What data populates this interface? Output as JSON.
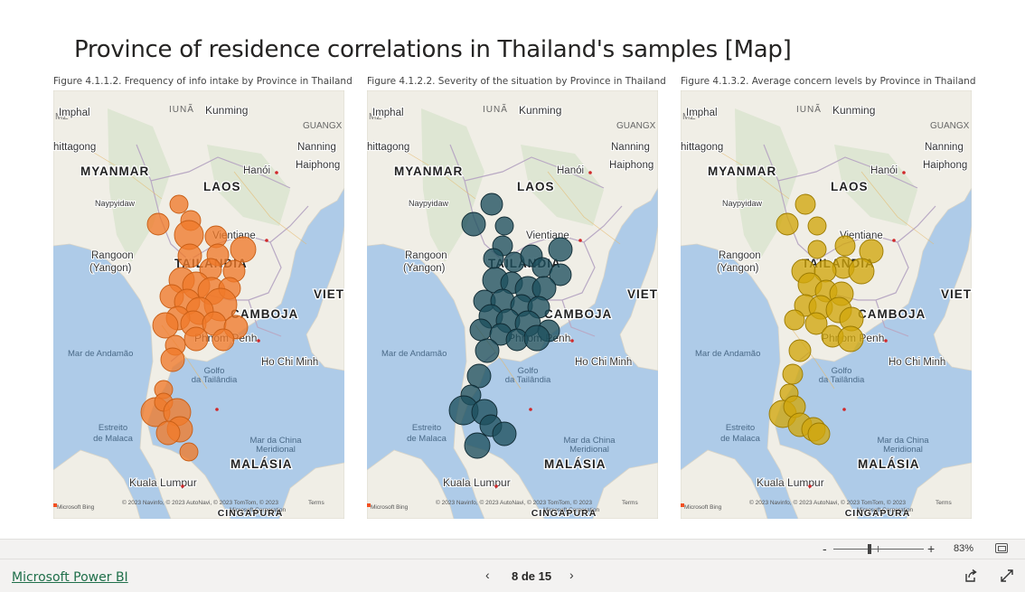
{
  "report": {
    "title": "Province of residence correlations in Thailand's samples [Map]"
  },
  "panels": [
    {
      "caption": "Figure 4.1.1.2. Frequency of info intake by Province in Thailand",
      "bubble_fill": "#f07a2a",
      "bubble_stroke": "#c85e16",
      "bubble_opacity": 0.78
    },
    {
      "caption": "Figure 4.1.2.2. Severity of the situation by Province in Thailand",
      "bubble_fill": "#1e4f5e",
      "bubble_stroke": "#0f2a33",
      "bubble_opacity": 0.78
    },
    {
      "caption": "Figure 4.1.3.2. Average concern levels by Province in Thailand",
      "bubble_fill": "#d1a70c",
      "bubble_stroke": "#9b7a00",
      "bubble_opacity": 0.78
    }
  ],
  "map_labels": {
    "imphal": "Imphal",
    "kunming": "Kunming",
    "yunnan": "IUNÃ",
    "guangxi": "GUANGX",
    "chittagong": "hittagong",
    "mz": "MZ",
    "nanning": "Nanning",
    "haiphong": "Haiphong",
    "hanoi": "Hanói",
    "myanmar": "MYANMAR",
    "laos": "LAOS",
    "naypyidaw": "Naypyidaw",
    "vientiane": "Vientiane",
    "rangoon": "Rangoon",
    "yangon": "(Yangon)",
    "thailandia": "TAILANDIA",
    "viet": "VIET",
    "camboja": "CAMBOJA",
    "phnom_penh": "Phnom Penh",
    "andaman": "Mar de Andamão",
    "ho_chi_minh": "Ho Chi Minh",
    "golfo": "Golfo",
    "da_tailandia": "da Tailândia",
    "estreito": "Estreito",
    "de_malaca": "de Malaca",
    "mar_china": "Mar da China",
    "meridional": "Meridional",
    "malasia": "MALÁSIA",
    "kuala_lumpur": "Kuala Lumpur",
    "cingapura": "CINGAPURA",
    "bing": "Microsoft Bing",
    "copyright": "© 2023 Navinfo, © 2023 AutoNavi, © 2023 TomTom, © 2023",
    "ms_corp": "Microsoft Corporation",
    "terms": "Terms"
  },
  "zoom": {
    "minus": "-",
    "plus": "+",
    "level": "83%"
  },
  "footer": {
    "brand": "Microsoft Power BI",
    "page_indicator": "8 de 15",
    "prev": "‹",
    "next": "›"
  }
}
